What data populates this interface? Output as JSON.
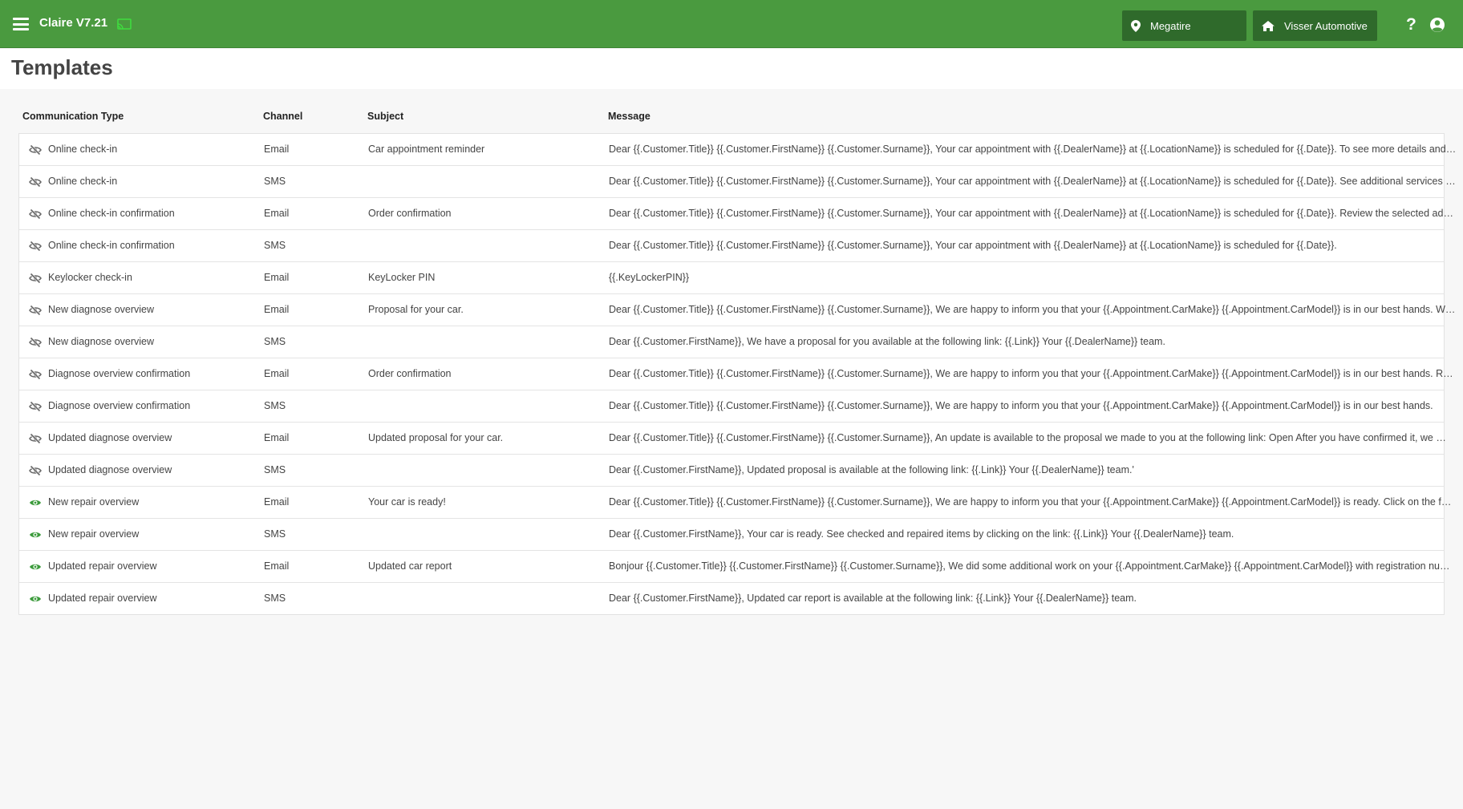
{
  "header": {
    "app_title": "Claire V7.21",
    "location": "Megatire",
    "dealer": "Visser Automotive",
    "help_label": "?"
  },
  "page": {
    "title": "Templates"
  },
  "table": {
    "columns": [
      "Communication Type",
      "Channel",
      "Subject",
      "Message"
    ],
    "rows": [
      {
        "visible": false,
        "type": "Online check-in",
        "channel": "Email",
        "subject": "Car appointment reminder",
        "message": "Dear {{.Customer.Title}} {{.Customer.FirstName}} {{.Customer.Surname}}, Your car appointment with {{.DealerName}} at {{.LocationName}} is scheduled for {{.Date}}. To see more details and …"
      },
      {
        "visible": false,
        "type": "Online check-in",
        "channel": "SMS",
        "subject": "",
        "message": "Dear {{.Customer.Title}} {{.Customer.FirstName}} {{.Customer.Surname}}, Your car appointment with {{.DealerName}} at {{.LocationName}} is scheduled for {{.Date}}. See additional services o…"
      },
      {
        "visible": false,
        "type": "Online check-in confirmation",
        "channel": "Email",
        "subject": "Order confirmation",
        "message": "Dear {{.Customer.Title}} {{.Customer.FirstName}} {{.Customer.Surname}}, Your car appointment with {{.DealerName}} at {{.LocationName}} is scheduled for {{.Date}}. Review the selected addi…"
      },
      {
        "visible": false,
        "type": "Online check-in confirmation",
        "channel": "SMS",
        "subject": "",
        "message": "Dear {{.Customer.Title}} {{.Customer.FirstName}} {{.Customer.Surname}}, Your car appointment with {{.DealerName}} at {{.LocationName}} is scheduled for {{.Date}}."
      },
      {
        "visible": false,
        "type": "Keylocker check-in",
        "channel": "Email",
        "subject": "KeyLocker PIN",
        "message": "{{.KeyLockerPIN}}"
      },
      {
        "visible": false,
        "type": "New diagnose overview",
        "channel": "Email",
        "subject": "Proposal for your car.",
        "message": "Dear {{.Customer.Title}} {{.Customer.FirstName}} {{.Customer.Surname}}, We are happy to inform you that your {{.Appointment.CarMake}} {{.Appointment.CarModel}} is in our best hands. W…"
      },
      {
        "visible": false,
        "type": "New diagnose overview",
        "channel": "SMS",
        "subject": "",
        "message": "Dear {{.Customer.FirstName}}, We have a proposal for you available at the following link: {{.Link}} Your {{.DealerName}} team."
      },
      {
        "visible": false,
        "type": "Diagnose overview confirmation",
        "channel": "Email",
        "subject": "Order confirmation",
        "message": "Dear {{.Customer.Title}} {{.Customer.FirstName}} {{.Customer.Surname}}, We are happy to inform you that your {{.Appointment.CarMake}} {{.Appointment.CarModel}} is in our best hands. R…"
      },
      {
        "visible": false,
        "type": "Diagnose overview confirmation",
        "channel": "SMS",
        "subject": "",
        "message": "Dear {{.Customer.Title}} {{.Customer.FirstName}} {{.Customer.Surname}}, We are happy to inform you that your {{.Appointment.CarMake}} {{.Appointment.CarModel}} is in our best hands."
      },
      {
        "visible": false,
        "type": "Updated diagnose overview",
        "channel": "Email",
        "subject": "Updated proposal for your car.",
        "message": "Dear {{.Customer.Title}} {{.Customer.FirstName}} {{.Customer.Surname}}, An update is available to the proposal we made to you at the following link: Open After you have confirmed it, we …"
      },
      {
        "visible": false,
        "type": "Updated diagnose overview",
        "channel": "SMS",
        "subject": "",
        "message": "Dear {{.Customer.FirstName}}, Updated proposal is available at the following link: {{.Link}} Your {{.DealerName}} team.'"
      },
      {
        "visible": true,
        "type": "New repair overview",
        "channel": "Email",
        "subject": "Your car is ready!",
        "message": "Dear {{.Customer.Title}} {{.Customer.FirstName}} {{.Customer.Surname}}, We are happy to inform you that your {{.Appointment.CarMake}} {{.Appointment.CarModel}} is ready. Click on the f…"
      },
      {
        "visible": true,
        "type": "New repair overview",
        "channel": "SMS",
        "subject": "",
        "message": "Dear {{.Customer.FirstName}}, Your car is ready. See checked and repaired items by clicking on the link: {{.Link}} Your {{.DealerName}} team."
      },
      {
        "visible": true,
        "type": "Updated repair overview",
        "channel": "Email",
        "subject": "Updated car report",
        "message": "Bonjour {{.Customer.Title}} {{.Customer.FirstName}} {{.Customer.Surname}}, We did some additional work on your {{.Appointment.CarMake}} {{.Appointment.CarModel}} with registration nu…"
      },
      {
        "visible": true,
        "type": "Updated repair overview",
        "channel": "SMS",
        "subject": "",
        "message": "Dear {{.Customer.FirstName}}, Updated car report is available at the following link: {{.Link}} Your {{.DealerName}} team."
      }
    ]
  },
  "icons": {
    "menu": "hamburger-menu-icon",
    "cast": "cast-icon",
    "location": "map-marker-icon",
    "dealer": "home-icon",
    "help": "question-mark-icon",
    "user": "user-circle-icon",
    "hidden": "eye-slash-icon",
    "visible": "eye-icon"
  },
  "colors": {
    "header_bg": "#4a9a3f",
    "pill_bg": "#2f6a2b",
    "visible_icon": "#3a9a3a",
    "hidden_icon": "#666666",
    "cast_icon": "#3fdc3f"
  }
}
